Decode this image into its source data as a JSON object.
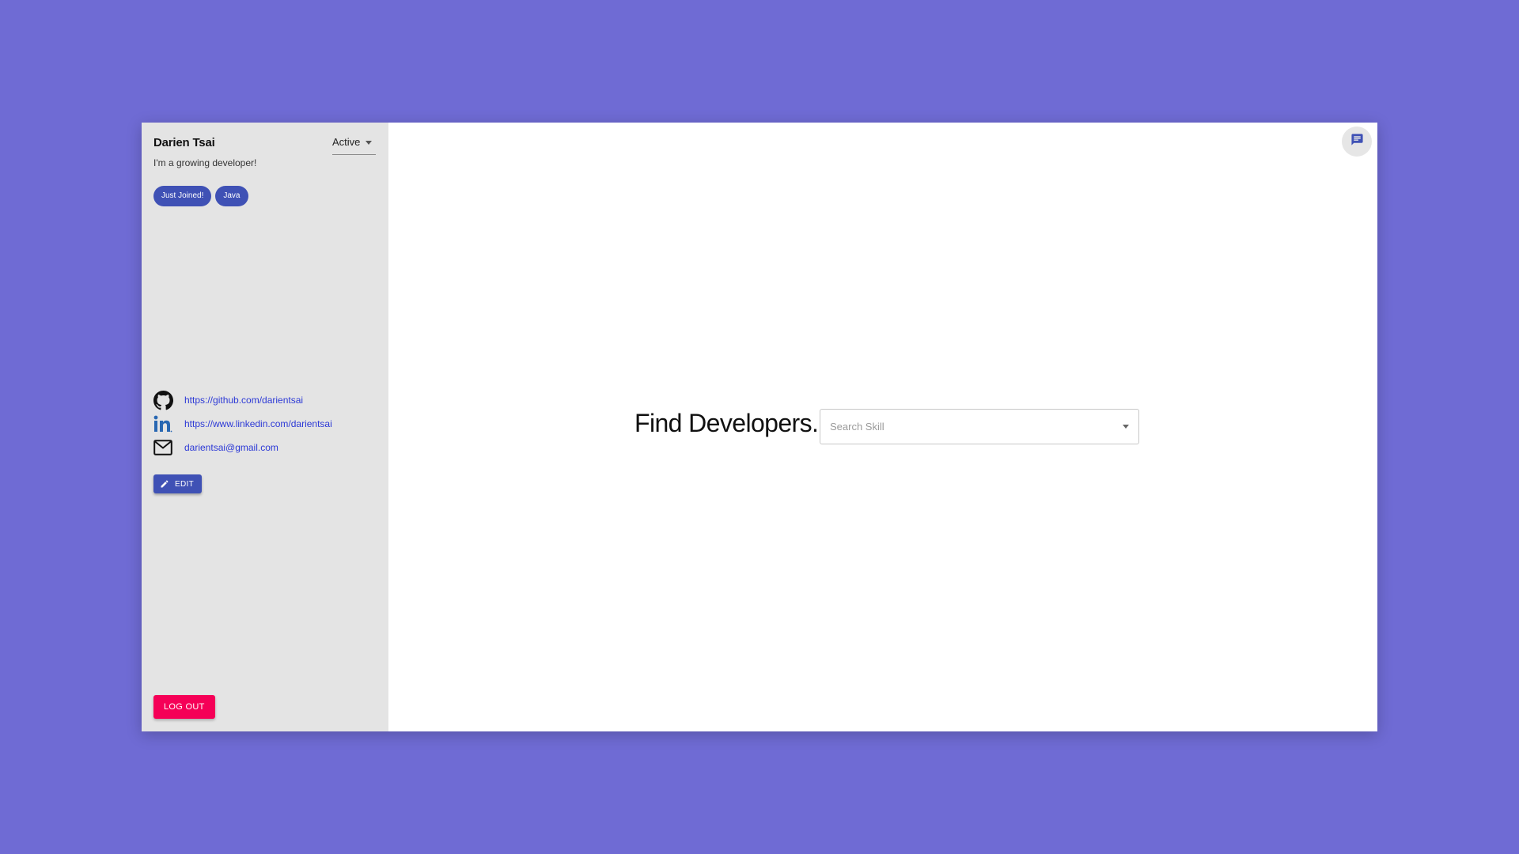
{
  "profile": {
    "name": "Darien Tsai",
    "bio": "I'm a growing developer!",
    "status": "Active",
    "tags": [
      "Just Joined!",
      "Java"
    ]
  },
  "links": {
    "github": "https://github.com/darientsai",
    "linkedin": "https://www.linkedin.com/darientsai",
    "email": "darientsai@gmail.com"
  },
  "buttons": {
    "edit": "EDIT",
    "logout": "LOG OUT"
  },
  "main": {
    "title": "Find Developers.",
    "search_placeholder": "Search Skill"
  },
  "icons": {
    "github": "github-icon",
    "linkedin": "linkedin-icon",
    "email": "mail-icon",
    "edit": "pencil-icon",
    "chat": "chat-icon",
    "status_dropdown": "chevron-down-icon",
    "search_dropdown": "chevron-down-icon"
  },
  "colors": {
    "background": "#6f6bd4",
    "primary": "#3f51b5",
    "logout": "#f50057",
    "link": "#2c39d6",
    "sidebar": "#e4e4e4"
  }
}
